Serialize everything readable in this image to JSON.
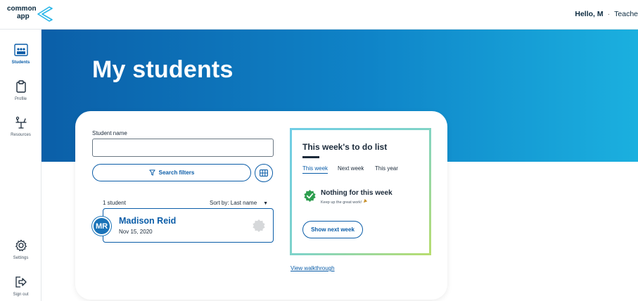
{
  "header": {
    "logo_line1": "common",
    "logo_line2": "app",
    "greeting": "Hello, M",
    "role": "Teache"
  },
  "sidebar": {
    "items": [
      {
        "label": "Students",
        "icon": "students-icon"
      },
      {
        "label": "Profile",
        "icon": "clipboard-icon"
      },
      {
        "label": "Resources",
        "icon": "resources-icon"
      },
      {
        "label": "Settings",
        "icon": "gear-icon"
      },
      {
        "label": "Sign out",
        "icon": "sign-out-icon"
      }
    ]
  },
  "main": {
    "title": "My students",
    "search": {
      "label": "Student name",
      "value": "",
      "filter_button": "Search filters"
    },
    "list": {
      "count": "1 student",
      "sort": "Sort by: Last name",
      "students": [
        {
          "initials": "MR",
          "name": "Madison Reid",
          "date": "Nov 15, 2020"
        }
      ]
    },
    "todo": {
      "title": "This week's to do list",
      "tabs": [
        "This week",
        "Next week",
        "This year"
      ],
      "empty_title": "Nothing for this week",
      "empty_subtitle": "Keep up the great work!",
      "button": "Show next week"
    },
    "walkthrough": "View walkthrough"
  },
  "colors": {
    "accent": "#0b5da8",
    "hero_start": "#0b5fa8",
    "hero_end": "#1bb0df",
    "success": "#2e9e4f"
  }
}
